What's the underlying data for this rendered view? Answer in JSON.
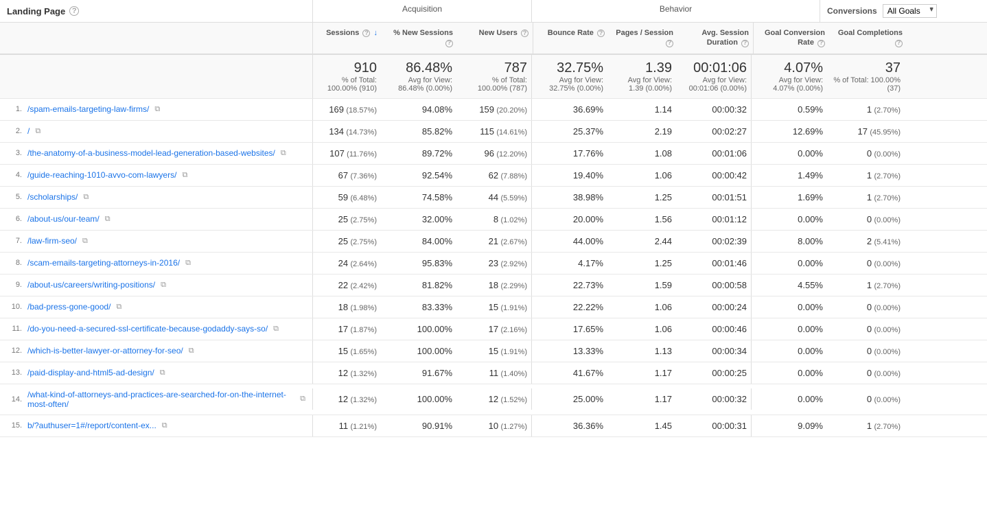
{
  "header": {
    "landing_page": "Landing Page",
    "help_icon": "?",
    "acquisition_label": "Acquisition",
    "behavior_label": "Behavior",
    "conversions_label": "Conversions",
    "all_goals_label": "All Goals",
    "cols": {
      "sessions": "Sessions",
      "new_sessions": "% New Sessions",
      "new_users": "New Users",
      "bounce_rate": "Bounce Rate",
      "pages_session": "Pages / Session",
      "avg_session": "Avg. Session Duration",
      "goal_conv_rate": "Goal Conversion Rate",
      "goal_completions": "Goal Completions"
    }
  },
  "totals": {
    "sessions": "910",
    "sessions_pct": "% of Total: 100.00% (910)",
    "new_sessions": "86.48%",
    "new_sessions_avg": "Avg for View: 86.48% (0.00%)",
    "new_users": "787",
    "new_users_pct": "% of Total: 100.00% (787)",
    "bounce_rate": "32.75%",
    "bounce_avg": "Avg for View: 32.75% (0.00%)",
    "pages_session": "1.39",
    "pages_avg": "Avg for View: 1.39 (0.00%)",
    "avg_session": "00:01:06",
    "avg_session_avg": "Avg for View: 00:01:06 (0.00%)",
    "goal_conv_rate": "4.07%",
    "goal_conv_avg": "Avg for View: 4.07% (0.00%)",
    "goal_completions": "37",
    "goal_comp_pct": "% of Total: 100.00% (37)"
  },
  "rows": [
    {
      "num": "1.",
      "page": "/spam-emails-targeting-law-firms/",
      "sessions": "169",
      "sessions_pct": "(18.57%)",
      "new_sessions": "94.08%",
      "new_users": "159",
      "new_users_pct": "(20.20%)",
      "bounce_rate": "36.69%",
      "pages_session": "1.14",
      "avg_session": "00:00:32",
      "goal_conv_rate": "0.59%",
      "goal_completions": "1",
      "goal_comp_pct": "(2.70%)"
    },
    {
      "num": "2.",
      "page": "/",
      "sessions": "134",
      "sessions_pct": "(14.73%)",
      "new_sessions": "85.82%",
      "new_users": "115",
      "new_users_pct": "(14.61%)",
      "bounce_rate": "25.37%",
      "pages_session": "2.19",
      "avg_session": "00:02:27",
      "goal_conv_rate": "12.69%",
      "goal_completions": "17",
      "goal_comp_pct": "(45.95%)"
    },
    {
      "num": "3.",
      "page": "/the-anatomy-of-a-business-model-lead-generation-based-websites/",
      "sessions": "107",
      "sessions_pct": "(11.76%)",
      "new_sessions": "89.72%",
      "new_users": "96",
      "new_users_pct": "(12.20%)",
      "bounce_rate": "17.76%",
      "pages_session": "1.08",
      "avg_session": "00:01:06",
      "goal_conv_rate": "0.00%",
      "goal_completions": "0",
      "goal_comp_pct": "(0.00%)"
    },
    {
      "num": "4.",
      "page": "/guide-reaching-1010-avvo-com-lawyers/",
      "sessions": "67",
      "sessions_pct": "(7.36%)",
      "new_sessions": "92.54%",
      "new_users": "62",
      "new_users_pct": "(7.88%)",
      "bounce_rate": "19.40%",
      "pages_session": "1.06",
      "avg_session": "00:00:42",
      "goal_conv_rate": "1.49%",
      "goal_completions": "1",
      "goal_comp_pct": "(2.70%)"
    },
    {
      "num": "5.",
      "page": "/scholarships/",
      "sessions": "59",
      "sessions_pct": "(6.48%)",
      "new_sessions": "74.58%",
      "new_users": "44",
      "new_users_pct": "(5.59%)",
      "bounce_rate": "38.98%",
      "pages_session": "1.25",
      "avg_session": "00:01:51",
      "goal_conv_rate": "1.69%",
      "goal_completions": "1",
      "goal_comp_pct": "(2.70%)"
    },
    {
      "num": "6.",
      "page": "/about-us/our-team/",
      "sessions": "25",
      "sessions_pct": "(2.75%)",
      "new_sessions": "32.00%",
      "new_users": "8",
      "new_users_pct": "(1.02%)",
      "bounce_rate": "20.00%",
      "pages_session": "1.56",
      "avg_session": "00:01:12",
      "goal_conv_rate": "0.00%",
      "goal_completions": "0",
      "goal_comp_pct": "(0.00%)"
    },
    {
      "num": "7.",
      "page": "/law-firm-seo/",
      "sessions": "25",
      "sessions_pct": "(2.75%)",
      "new_sessions": "84.00%",
      "new_users": "21",
      "new_users_pct": "(2.67%)",
      "bounce_rate": "44.00%",
      "pages_session": "2.44",
      "avg_session": "00:02:39",
      "goal_conv_rate": "8.00%",
      "goal_completions": "2",
      "goal_comp_pct": "(5.41%)"
    },
    {
      "num": "8.",
      "page": "/scam-emails-targeting-attorneys-in-2016/",
      "sessions": "24",
      "sessions_pct": "(2.64%)",
      "new_sessions": "95.83%",
      "new_users": "23",
      "new_users_pct": "(2.92%)",
      "bounce_rate": "4.17%",
      "pages_session": "1.25",
      "avg_session": "00:01:46",
      "goal_conv_rate": "0.00%",
      "goal_completions": "0",
      "goal_comp_pct": "(0.00%)"
    },
    {
      "num": "9.",
      "page": "/about-us/careers/writing-positions/",
      "sessions": "22",
      "sessions_pct": "(2.42%)",
      "new_sessions": "81.82%",
      "new_users": "18",
      "new_users_pct": "(2.29%)",
      "bounce_rate": "22.73%",
      "pages_session": "1.59",
      "avg_session": "00:00:58",
      "goal_conv_rate": "4.55%",
      "goal_completions": "1",
      "goal_comp_pct": "(2.70%)"
    },
    {
      "num": "10.",
      "page": "/bad-press-gone-good/",
      "sessions": "18",
      "sessions_pct": "(1.98%)",
      "new_sessions": "83.33%",
      "new_users": "15",
      "new_users_pct": "(1.91%)",
      "bounce_rate": "22.22%",
      "pages_session": "1.06",
      "avg_session": "00:00:24",
      "goal_conv_rate": "0.00%",
      "goal_completions": "0",
      "goal_comp_pct": "(0.00%)"
    },
    {
      "num": "11.",
      "page": "/do-you-need-a-secured-ssl-certificate-because-godaddy-says-so/",
      "sessions": "17",
      "sessions_pct": "(1.87%)",
      "new_sessions": "100.00%",
      "new_users": "17",
      "new_users_pct": "(2.16%)",
      "bounce_rate": "17.65%",
      "pages_session": "1.06",
      "avg_session": "00:00:46",
      "goal_conv_rate": "0.00%",
      "goal_completions": "0",
      "goal_comp_pct": "(0.00%)"
    },
    {
      "num": "12.",
      "page": "/which-is-better-lawyer-or-attorney-for-seo/",
      "sessions": "15",
      "sessions_pct": "(1.65%)",
      "new_sessions": "100.00%",
      "new_users": "15",
      "new_users_pct": "(1.91%)",
      "bounce_rate": "13.33%",
      "pages_session": "1.13",
      "avg_session": "00:00:34",
      "goal_conv_rate": "0.00%",
      "goal_completions": "0",
      "goal_comp_pct": "(0.00%)"
    },
    {
      "num": "13.",
      "page": "/paid-display-and-html5-ad-design/",
      "sessions": "12",
      "sessions_pct": "(1.32%)",
      "new_sessions": "91.67%",
      "new_users": "11",
      "new_users_pct": "(1.40%)",
      "bounce_rate": "41.67%",
      "pages_session": "1.17",
      "avg_session": "00:00:25",
      "goal_conv_rate": "0.00%",
      "goal_completions": "0",
      "goal_comp_pct": "(0.00%)"
    },
    {
      "num": "14.",
      "page": "/what-kind-of-attorneys-and-practices-are-searched-for-on-the-internet-most-often/",
      "sessions": "12",
      "sessions_pct": "(1.32%)",
      "new_sessions": "100.00%",
      "new_users": "12",
      "new_users_pct": "(1.52%)",
      "bounce_rate": "25.00%",
      "pages_session": "1.17",
      "avg_session": "00:00:32",
      "goal_conv_rate": "0.00%",
      "goal_completions": "0",
      "goal_comp_pct": "(0.00%)"
    },
    {
      "num": "15.",
      "page": "b/?authuser=1#/report/content-ex...",
      "sessions": "11",
      "sessions_pct": "(1.21%)",
      "new_sessions": "90.91%",
      "new_users": "10",
      "new_users_pct": "(1.27%)",
      "bounce_rate": "36.36%",
      "pages_session": "1.45",
      "avg_session": "00:00:31",
      "goal_conv_rate": "9.09%",
      "goal_completions": "1",
      "goal_comp_pct": "(2.70%)"
    }
  ]
}
